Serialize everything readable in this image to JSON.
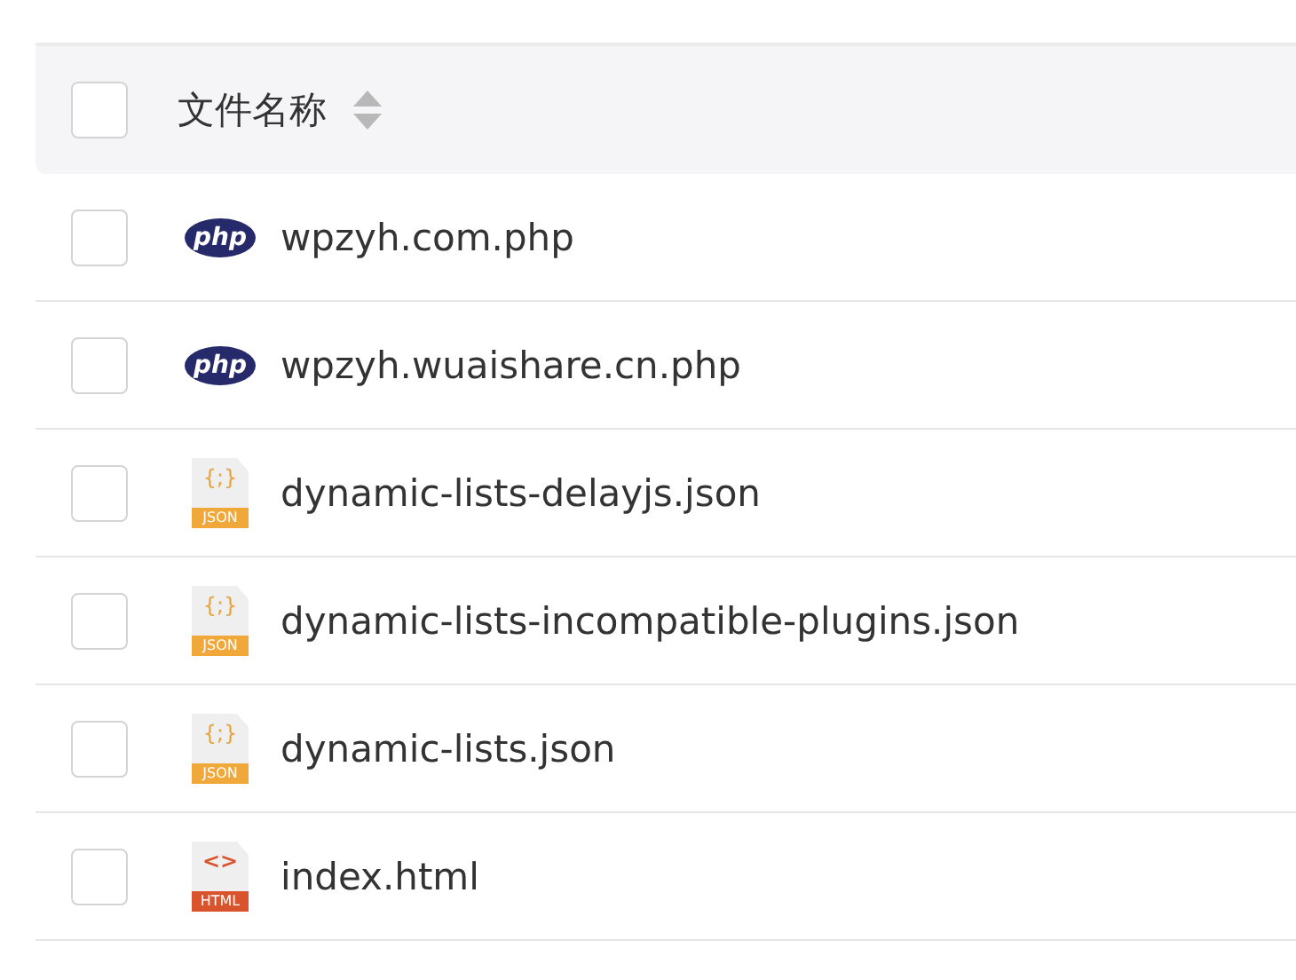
{
  "header": {
    "checked": false,
    "label": "文件名称"
  },
  "rows": [
    {
      "kind": "php",
      "icon_text": "php",
      "name": "wpzyh.com.php",
      "checked": false
    },
    {
      "kind": "php",
      "icon_text": "php",
      "name": "wpzyh.wuaishare.cn.php",
      "checked": false
    },
    {
      "kind": "json",
      "icon_glyph": "{;}",
      "icon_text": "JSON",
      "name": "dynamic-lists-delayjs.json",
      "checked": false
    },
    {
      "kind": "json",
      "icon_glyph": "{;}",
      "icon_text": "JSON",
      "name": "dynamic-lists-incompatible-plugins.json",
      "checked": false
    },
    {
      "kind": "json",
      "icon_glyph": "{;}",
      "icon_text": "JSON",
      "name": "dynamic-lists.json",
      "checked": false
    },
    {
      "kind": "html",
      "icon_glyph": "<>",
      "icon_text": "HTML",
      "name": "index.html",
      "checked": false
    }
  ]
}
